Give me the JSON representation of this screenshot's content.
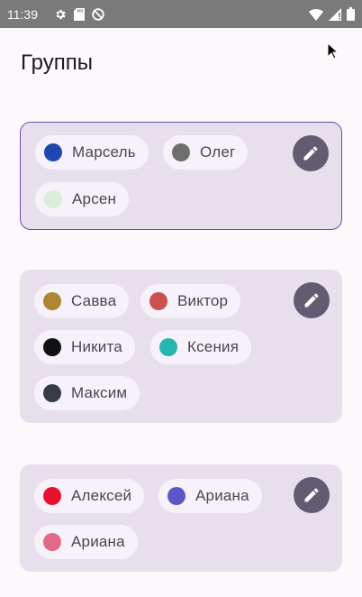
{
  "status_bar": {
    "time": "11:39",
    "icons_left": [
      "gear-icon",
      "sd-card-icon",
      "do-not-disturb-icon"
    ],
    "icons_right": [
      "wifi-icon",
      "signal-icon",
      "battery-icon"
    ]
  },
  "page": {
    "title": "Группы"
  },
  "groups": [
    {
      "selected": true,
      "members": [
        {
          "name": "Марсель",
          "color": "#1e48b0"
        },
        {
          "name": "Олег",
          "color": "#6e6e6e"
        },
        {
          "name": "Арсен",
          "color": "#d8eddb"
        }
      ],
      "edit_icon": "pencil-icon"
    },
    {
      "selected": false,
      "members": [
        {
          "name": "Савва",
          "color": "#b08532"
        },
        {
          "name": "Виктор",
          "color": "#c9514f"
        },
        {
          "name": "Никита",
          "color": "#111111"
        },
        {
          "name": "Ксения",
          "color": "#26b6b0"
        },
        {
          "name": "Максим",
          "color": "#363b45"
        }
      ],
      "edit_icon": "pencil-icon"
    },
    {
      "selected": false,
      "members": [
        {
          "name": "Алексей",
          "color": "#ec0f30"
        },
        {
          "name": "Ариана",
          "color": "#5b57c9"
        },
        {
          "name": "Ариана",
          "color": "#e06a88"
        }
      ],
      "edit_icon": "pencil-icon"
    }
  ]
}
